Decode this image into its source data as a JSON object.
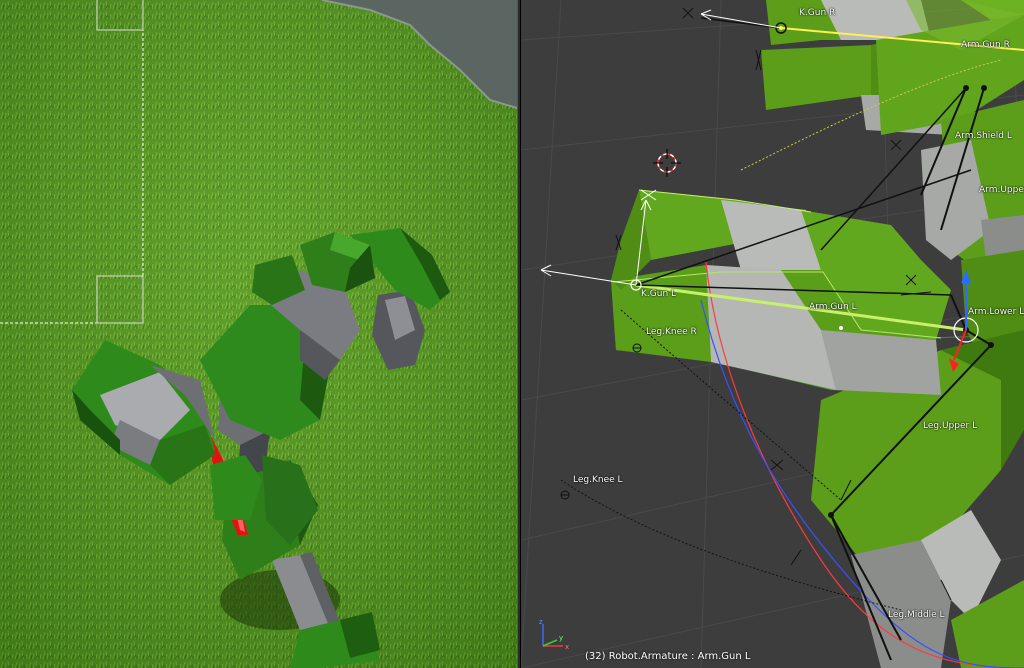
{
  "viewport": {
    "status_frame": "(32)",
    "status_object": "Robot.Armature",
    "status_separator": ":",
    "status_bone": "Arm.Gun L"
  },
  "bones": {
    "k_gun_r": "K.Gun R",
    "arm_gun_r": "Arm.Gun R",
    "arm_shield_l": "Arm.Shield L",
    "arm_upper": "Arm.Upper",
    "k_gun_l": "K.Gun L",
    "arm_gun_l": "Arm.Gun L",
    "arm_lower": "Arm.Lower L",
    "leg_knee_r": "Leg.Knee R",
    "leg_upper_l": "Leg.Upper L",
    "leg_knee_l": "Leg.Knee L",
    "leg_middle_l": "Leg.Middle L"
  },
  "colors": {
    "grass": "#4e8f1e",
    "viewport_bg": "#3d3d3d",
    "mesh_green": "#5a9e1a",
    "mesh_grey": "#b4b7b4",
    "selection_green": "#c8f06a",
    "active_bone_yellow": "#ffee55",
    "robot_green": "#2a7a18"
  },
  "icons": {
    "axis_gizmo": "axis-gizmo-icon",
    "cursor": "3d-cursor-icon"
  }
}
